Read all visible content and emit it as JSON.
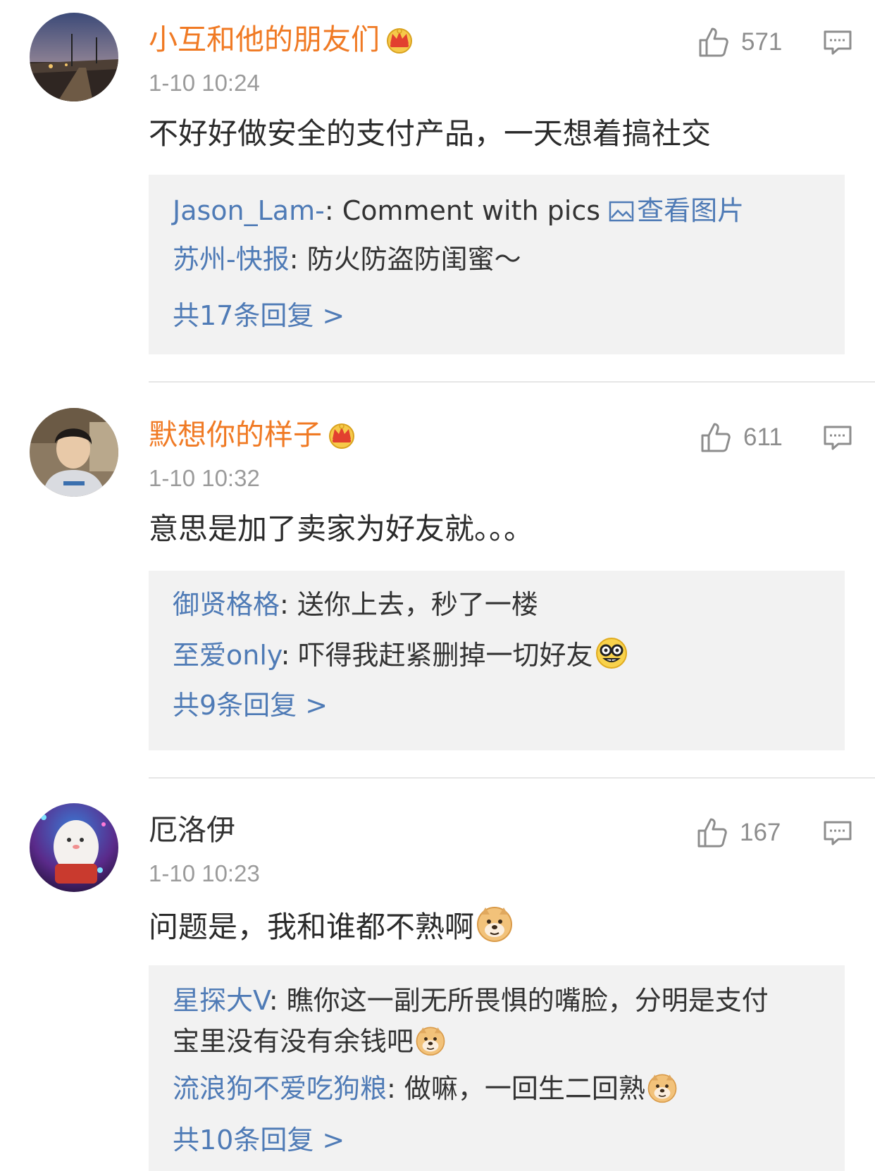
{
  "comments": [
    {
      "username": "小互和他的朋友们",
      "time": "1-10 10:24",
      "text": "不好好做安全的支付产品，一天想着搞社交",
      "likes": "571",
      "replies": [
        {
          "user": "Jason_Lam-",
          "sep": ": ",
          "text": "Comment with pics ",
          "link": "查看图片"
        },
        {
          "user": "苏州-快报",
          "sep": ": ",
          "text": "防火防盗防闺蜜～"
        }
      ],
      "more": "共17条回复 >"
    },
    {
      "username": "默想你的样子",
      "time": "1-10 10:32",
      "text": "意思是加了卖家为好友就。。。",
      "likes": "611",
      "replies": [
        {
          "user": "御贤格格",
          "sep": ": ",
          "text": "送你上去，秒了一楼"
        },
        {
          "user": "至爱only",
          "sep": ": ",
          "text": "吓得我赶紧删掉一切好友"
        }
      ],
      "more": "共9条回复 >"
    },
    {
      "username": "厄洛伊",
      "time": "1-10 10:23",
      "text": "问题是，我和谁都不熟啊",
      "likes": "167",
      "replies": [
        {
          "user": "星探大V",
          "sep": ": ",
          "text": "瞧你这一副无所畏惧的嘴脸，分明是支付",
          "text2": "宝里没有没有余钱吧"
        },
        {
          "user": "流浪狗不爱吃狗粮",
          "sep": ": ",
          "text": "做嘛，一回生二回熟"
        }
      ],
      "more": "共10条回复 >"
    }
  ],
  "icons": {
    "like": "thumbs-up-icon",
    "reply": "comment-bubble-icon",
    "vip": "crown-icon",
    "pic": "image-icon",
    "doge": "doge-emoji",
    "nerd": "nerd-emoji"
  },
  "colors": {
    "vip_name": "#f07a24",
    "reply_user": "#4f7bb6",
    "timestamp": "#9b9b9b",
    "reply_bg": "#f2f2f2"
  }
}
